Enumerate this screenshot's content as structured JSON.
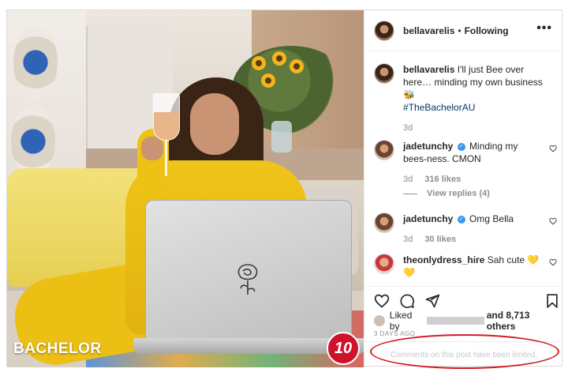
{
  "header": {
    "username": "bellavarelis",
    "separator": "•",
    "follow_status": "Following",
    "more_label": "•••"
  },
  "caption": {
    "username": "bellavarelis",
    "text": "I'll just Bee over here… minding my own business 🐝",
    "hashtag": "#TheBachelorAU",
    "time": "3d"
  },
  "comments": [
    {
      "username": "jadetunchy",
      "verified": true,
      "text": "Minding my bees-ness. CMON",
      "time": "3d",
      "likes": "316 likes"
    },
    {
      "username": "jadetunchy",
      "verified": true,
      "text": "Omg Bella",
      "time": "3d",
      "likes": "30 likes"
    },
    {
      "username": "theonlydress_hire",
      "verified": false,
      "text": "Sah cute 💛💛"
    }
  ],
  "view_replies": "View replies (4)",
  "likes": {
    "prefix": "Liked by",
    "suffix": "and 8,713 others"
  },
  "timestamp": "3 DAYS AGO",
  "comments_limited": "Comments on this post have been limited.",
  "photo": {
    "show_logo": "BACHELOR",
    "network_logo": "10"
  },
  "icons": {
    "more": "more-options-icon",
    "like": "heart-icon",
    "comment": "comment-icon",
    "share": "share-icon",
    "save": "bookmark-icon",
    "verified": "verified-badge-icon"
  },
  "colors": {
    "link": "#00376b",
    "verified": "#3897f0",
    "muted": "#8e8e8e",
    "highlight_oval": "#d31a28",
    "network_red": "#d0112b"
  }
}
